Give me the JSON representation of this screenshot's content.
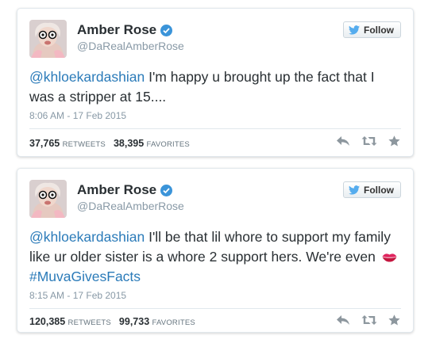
{
  "tweets": [
    {
      "name": "Amber Rose",
      "handle": "@DaRealAmberRose",
      "follow_label": "Follow",
      "mention": "@khloekardashian",
      "text": "I'm happy u brought up the fact that I was a stripper at 15....",
      "timestamp": "8:06 AM - 17 Feb 2015",
      "retweets": "37,765",
      "retweets_label": "RETWEETS",
      "favorites": "38,395",
      "favorites_label": "FAVORITES"
    },
    {
      "name": "Amber Rose",
      "handle": "@DaRealAmberRose",
      "follow_label": "Follow",
      "mention": "@khloekardashian",
      "text": "I'll be that lil whore to support my family like ur older sister is a whore 2 support hers. We're even",
      "emoji": "lips-emoji",
      "hashtag": "#MuvaGivesFacts",
      "timestamp": "8:15 AM - 17 Feb 2015",
      "retweets": "120,385",
      "retweets_label": "RETWEETS",
      "favorites": "99,733",
      "favorites_label": "FAVORITES"
    }
  ],
  "icons": {
    "verified": "verified-badge-icon",
    "follow": "twitter-bird-icon",
    "reply": "reply-icon",
    "retweet": "retweet-icon",
    "favorite": "star-icon"
  },
  "colors": {
    "link": "#2b7bb9",
    "verified": "#3b94d9",
    "muted": "#8899a6",
    "bird": "#55acee",
    "action_icon": "#8d979e",
    "lips": "#e0245e"
  }
}
